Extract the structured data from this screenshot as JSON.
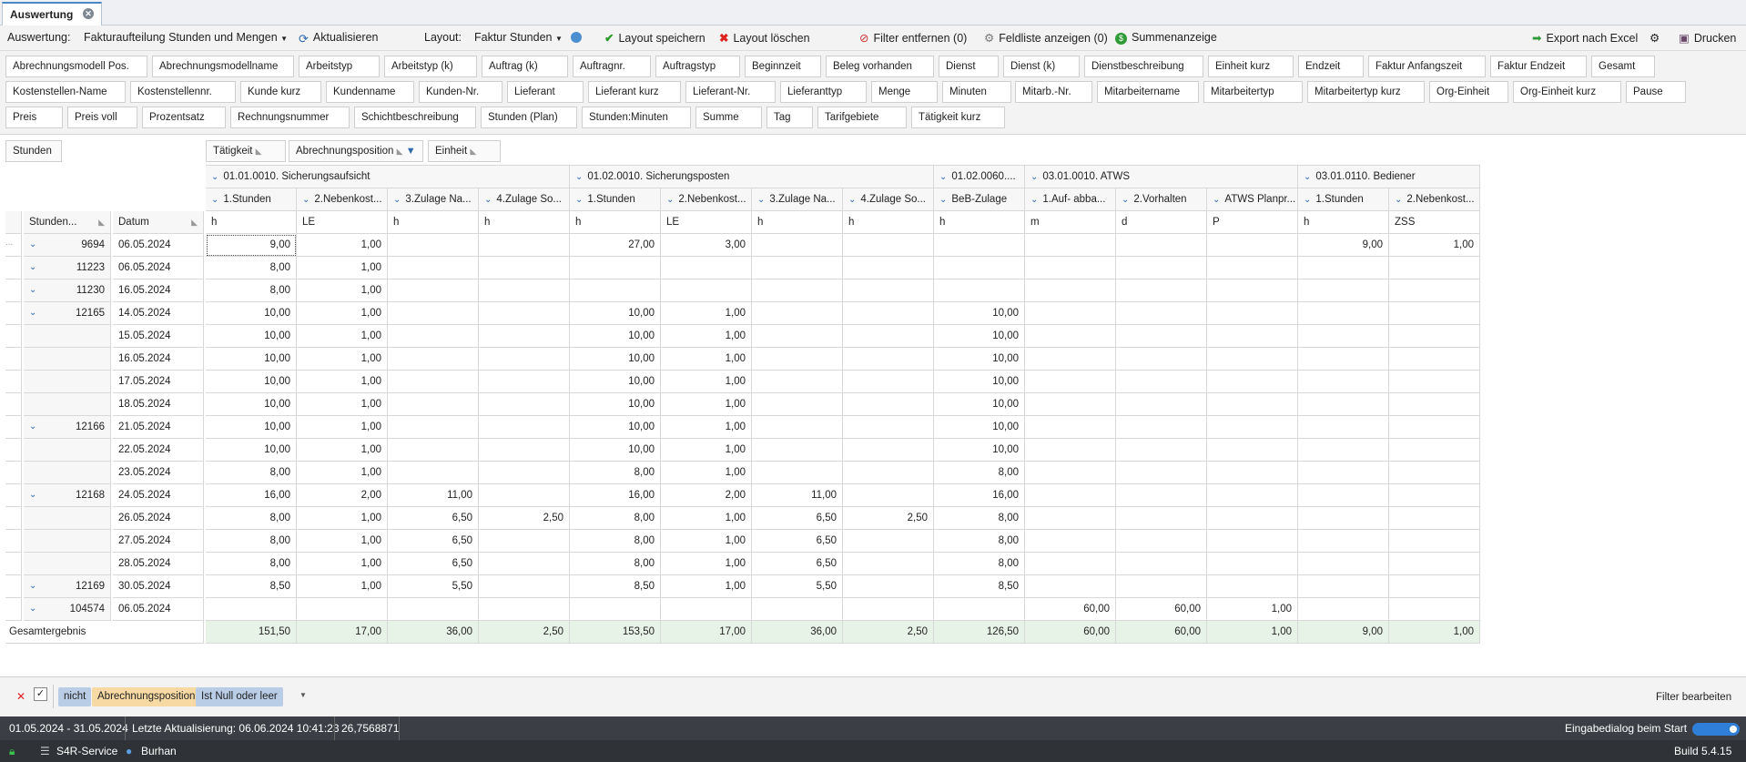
{
  "tab": {
    "title": "Auswertung"
  },
  "toolbar": {
    "auswertung_label": "Auswertung:",
    "auswertung_value": "Fakturaufteilung Stunden und Mengen",
    "refresh": "Aktualisieren",
    "layout_label": "Layout:",
    "layout_value": "Faktur Stunden",
    "save_layout": "Layout speichern",
    "delete_layout": "Layout löschen",
    "remove_filter": "Filter entfernen (0)",
    "show_fieldlist": "Feldliste anzeigen (0)",
    "sum_display": "Summenanzeige",
    "export": "Export nach Excel",
    "print": "Drucken"
  },
  "fields_row1": [
    "Abrechnungsmodell Pos.",
    "Abrechnungsmodellname",
    "Arbeitstyp",
    "Arbeitstyp (k)",
    "Auftrag (k)",
    "Auftragnr.",
    "Auftragstyp",
    "Beginnzeit",
    "Beleg vorhanden",
    "Dienst",
    "Dienst (k)",
    "Dienstbeschreibung",
    "Einheit kurz",
    "Endzeit",
    "Faktur Anfangszeit",
    "Faktur Endzeit",
    "Gesamt"
  ],
  "fields_row2": [
    "Kostenstellen-Name",
    "Kostenstellennr.",
    "Kunde kurz",
    "Kundenname",
    "Kunden-Nr.",
    "Lieferant",
    "Lieferant kurz",
    "Lieferant-Nr.",
    "Lieferanttyp",
    "Menge",
    "Minuten",
    "Mitarb.-Nr.",
    "Mitarbeitername",
    "Mitarbeitertyp",
    "Mitarbeitertyp kurz",
    "Org-Einheit",
    "Org-Einheit kurz",
    "Pause"
  ],
  "fields_row3": [
    "Preis",
    "Preis voll",
    "Prozentsatz",
    "Rechnungsnummer",
    "Schichtbeschreibung",
    "Stunden (Plan)",
    "Stunden:Minuten",
    "Summe",
    "Tag",
    "Tarifgebiete",
    "Tätigkeit kurz"
  ],
  "pivot": {
    "data_field": "Stunden",
    "col_fields": [
      "Tätigkeit",
      "Abrechnungsposition",
      "Einheit"
    ],
    "row_fields": [
      "Stunden...",
      "Datum"
    ],
    "groups": [
      {
        "label": "01.01.0010. Sicherungsaufsicht",
        "span": 4
      },
      {
        "label": "01.02.0010. Sicherungsposten",
        "span": 4
      },
      {
        "label": "01.02.0060....",
        "span": 1
      },
      {
        "label": "03.01.0010. ATWS",
        "span": 3
      },
      {
        "label": "03.01.0110. Bediener",
        "span": 2
      }
    ],
    "positions": [
      "1.Stunden",
      "2.Nebenkost...",
      "3.Zulage Na...",
      "4.Zulage So...",
      "1.Stunden",
      "2.Nebenkost...",
      "3.Zulage Na...",
      "4.Zulage So...",
      "BeB-Zulage",
      "1.Auf- abba...",
      "2.Vorhalten",
      "ATWS Planpr...",
      "1.Stunden",
      "2.Nebenkost..."
    ],
    "units": [
      "h",
      "LE",
      "h",
      "h",
      "h",
      "LE",
      "h",
      "h",
      "h",
      "m",
      "d",
      "P",
      "h",
      "ZSS"
    ],
    "rows": [
      {
        "id": "9694",
        "date": "06.05.2024",
        "v": [
          "9,00",
          "1,00",
          "",
          "",
          "27,00",
          "3,00",
          "",
          "",
          "",
          "",
          "",
          "",
          "9,00",
          "1,00"
        ]
      },
      {
        "id": "11223",
        "date": "06.05.2024",
        "v": [
          "8,00",
          "1,00",
          "",
          "",
          "",
          "",
          "",
          "",
          "",
          "",
          "",
          "",
          "",
          ""
        ]
      },
      {
        "id": "11230",
        "date": "16.05.2024",
        "v": [
          "8,00",
          "1,00",
          "",
          "",
          "",
          "",
          "",
          "",
          "",
          "",
          "",
          "",
          "",
          ""
        ]
      },
      {
        "id": "12165",
        "date": "14.05.2024",
        "v": [
          "10,00",
          "1,00",
          "",
          "",
          "10,00",
          "1,00",
          "",
          "",
          "10,00",
          "",
          "",
          "",
          "",
          ""
        ]
      },
      {
        "id": "",
        "date": "15.05.2024",
        "v": [
          "10,00",
          "1,00",
          "",
          "",
          "10,00",
          "1,00",
          "",
          "",
          "10,00",
          "",
          "",
          "",
          "",
          ""
        ]
      },
      {
        "id": "",
        "date": "16.05.2024",
        "v": [
          "10,00",
          "1,00",
          "",
          "",
          "10,00",
          "1,00",
          "",
          "",
          "10,00",
          "",
          "",
          "",
          "",
          ""
        ]
      },
      {
        "id": "",
        "date": "17.05.2024",
        "v": [
          "10,00",
          "1,00",
          "",
          "",
          "10,00",
          "1,00",
          "",
          "",
          "10,00",
          "",
          "",
          "",
          "",
          ""
        ]
      },
      {
        "id": "",
        "date": "18.05.2024",
        "v": [
          "10,00",
          "1,00",
          "",
          "",
          "10,00",
          "1,00",
          "",
          "",
          "10,00",
          "",
          "",
          "",
          "",
          ""
        ]
      },
      {
        "id": "12166",
        "date": "21.05.2024",
        "v": [
          "10,00",
          "1,00",
          "",
          "",
          "10,00",
          "1,00",
          "",
          "",
          "10,00",
          "",
          "",
          "",
          "",
          ""
        ]
      },
      {
        "id": "",
        "date": "22.05.2024",
        "v": [
          "10,00",
          "1,00",
          "",
          "",
          "10,00",
          "1,00",
          "",
          "",
          "10,00",
          "",
          "",
          "",
          "",
          ""
        ]
      },
      {
        "id": "",
        "date": "23.05.2024",
        "v": [
          "8,00",
          "1,00",
          "",
          "",
          "8,00",
          "1,00",
          "",
          "",
          "8,00",
          "",
          "",
          "",
          "",
          ""
        ]
      },
      {
        "id": "12168",
        "date": "24.05.2024",
        "v": [
          "16,00",
          "2,00",
          "11,00",
          "",
          "16,00",
          "2,00",
          "11,00",
          "",
          "16,00",
          "",
          "",
          "",
          "",
          ""
        ]
      },
      {
        "id": "",
        "date": "26.05.2024",
        "v": [
          "8,00",
          "1,00",
          "6,50",
          "2,50",
          "8,00",
          "1,00",
          "6,50",
          "2,50",
          "8,00",
          "",
          "",
          "",
          "",
          ""
        ]
      },
      {
        "id": "",
        "date": "27.05.2024",
        "v": [
          "8,00",
          "1,00",
          "6,50",
          "",
          "8,00",
          "1,00",
          "6,50",
          "",
          "8,00",
          "",
          "",
          "",
          "",
          ""
        ]
      },
      {
        "id": "",
        "date": "28.05.2024",
        "v": [
          "8,00",
          "1,00",
          "6,50",
          "",
          "8,00",
          "1,00",
          "6,50",
          "",
          "8,00",
          "",
          "",
          "",
          "",
          ""
        ]
      },
      {
        "id": "12169",
        "date": "30.05.2024",
        "v": [
          "8,50",
          "1,00",
          "5,50",
          "",
          "8,50",
          "1,00",
          "5,50",
          "",
          "8,50",
          "",
          "",
          "",
          "",
          ""
        ]
      },
      {
        "id": "104574",
        "date": "06.05.2024",
        "v": [
          "",
          "",
          "",
          "",
          "",
          "",
          "",
          "",
          "",
          "60,00",
          "60,00",
          "1,00",
          "",
          ""
        ]
      }
    ],
    "total_label": "Gesamtergebnis",
    "totals": [
      "151,50",
      "17,00",
      "36,00",
      "2,50",
      "153,50",
      "17,00",
      "36,00",
      "2,50",
      "126,50",
      "60,00",
      "60,00",
      "1,00",
      "9,00",
      "1,00"
    ]
  },
  "filter": {
    "not": "nicht",
    "field": "Abrechnungsposition",
    "op": "Ist Null oder leer",
    "edit": "Filter bearbeiten"
  },
  "status": {
    "range": "01.05.2024 - 31.05.2024",
    "last_update": "Letzte Aktualisierung: 06.06.2024 10:41:23",
    "value": "26,7568871",
    "start_dialog": "Eingabedialog beim Start",
    "service": "S4R-Service",
    "user": "Burhan",
    "build": "Build 5.4.15"
  },
  "colors": {
    "accent": "#4a87c6",
    "total_bg": "#e8f3e8",
    "statusbar": "#3b3f45",
    "toggle": "#2f7fd8",
    "filter_not": "#b9cde6",
    "filter_field": "#f7d9a4",
    "filter_op": "#b9cde6"
  }
}
